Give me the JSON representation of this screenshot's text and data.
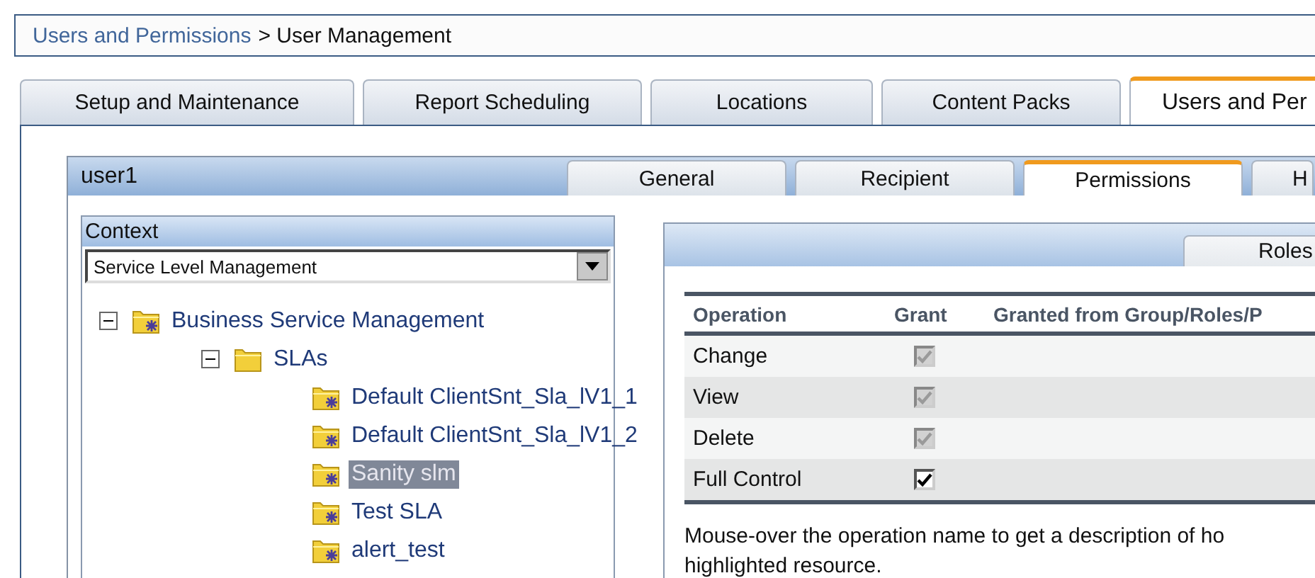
{
  "breadcrumb": {
    "link": "Users and Permissions",
    "current": "> User Management"
  },
  "main_tabs": [
    {
      "label": "Setup and Maintenance",
      "selected": false
    },
    {
      "label": "Report Scheduling",
      "selected": false
    },
    {
      "label": "Locations",
      "selected": false
    },
    {
      "label": "Content Packs",
      "selected": false
    },
    {
      "label": "Users and Per",
      "selected": true
    }
  ],
  "user_panel": {
    "title": "user1",
    "tabs": [
      {
        "label": "General",
        "selected": false
      },
      {
        "label": "Recipient",
        "selected": false
      },
      {
        "label": "Permissions",
        "selected": true
      },
      {
        "label": "H",
        "selected": false
      }
    ]
  },
  "context": {
    "title": "Context",
    "dropdown": "Service Level Management",
    "tree": [
      {
        "label": "Business Service Management",
        "kind": "folder-star",
        "expanded": true,
        "selected": false,
        "children": [
          {
            "label": "SLAs",
            "kind": "folder",
            "expanded": true,
            "selected": false,
            "children": [
              {
                "label": "Default ClientSnt_Sla_lV1_1",
                "kind": "folder-star",
                "selected": false
              },
              {
                "label": "Default ClientSnt_Sla_lV1_2",
                "kind": "folder-star",
                "selected": false
              },
              {
                "label": "Sanity slm",
                "kind": "folder-star",
                "selected": true
              },
              {
                "label": "Test SLA",
                "kind": "folder-star",
                "selected": false
              },
              {
                "label": "alert_test",
                "kind": "folder-star",
                "selected": false
              }
            ]
          }
        ]
      }
    ]
  },
  "permissions": {
    "tabs": [
      {
        "label": "Roles",
        "selected": false
      }
    ],
    "columns": [
      "Operation",
      "Grant",
      "Granted from Group/Roles/P"
    ],
    "rows": [
      {
        "operation": "Change",
        "checked": true,
        "disabled": true
      },
      {
        "operation": "View",
        "checked": true,
        "disabled": true
      },
      {
        "operation": "Delete",
        "checked": true,
        "disabled": true
      },
      {
        "operation": "Full Control",
        "checked": true,
        "disabled": false
      }
    ],
    "note": "Mouse-over the operation name to get a description of ho",
    "note_2": "highlighted resource."
  }
}
